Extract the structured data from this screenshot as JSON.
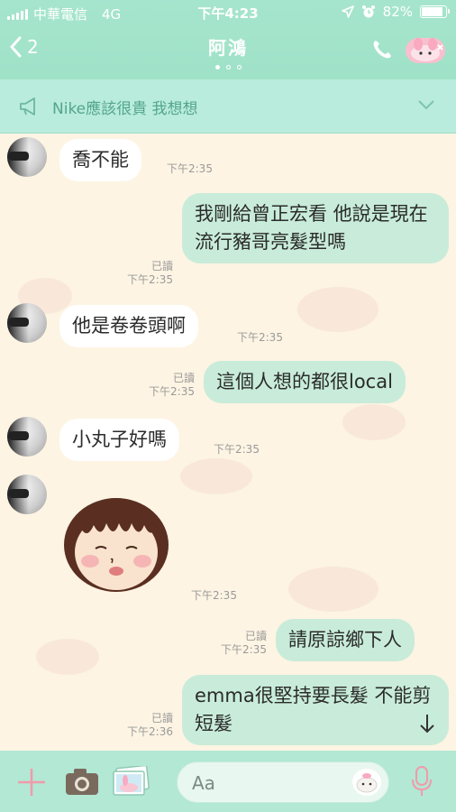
{
  "status_bar": {
    "carrier": "中華電信",
    "network": "4G",
    "time": "下午4:23",
    "battery": "82%",
    "battery_level": 0.82
  },
  "header": {
    "back_count": "2",
    "title": "阿鴻"
  },
  "notice": {
    "text": "Nike應該很貴 我想想"
  },
  "messages": [
    {
      "side": "in",
      "text": "喬不能",
      "time": "下午2:35"
    },
    {
      "side": "out",
      "text": "我剛給曾正宏看 他說是現在流行豬哥亮髮型嗎",
      "read": "已讀",
      "time": "下午2:35"
    },
    {
      "side": "in",
      "text": "他是卷卷頭啊",
      "time": "下午2:35"
    },
    {
      "side": "out",
      "text": "這個人想的都很local",
      "read": "已讀",
      "time": "下午2:35"
    },
    {
      "side": "in",
      "text": "小丸子好嗎",
      "time": "下午2:35"
    },
    {
      "side": "in",
      "type": "sticker",
      "sticker": "chibi-girl-sticker",
      "time": "下午2:35"
    },
    {
      "side": "out",
      "text": "請原諒鄉下人",
      "read": "已讀",
      "time": "下午2:35"
    },
    {
      "side": "out",
      "text": "emma很堅持要長髮 不能剪短髮",
      "read": "已讀",
      "time": "下午2:36"
    }
  ],
  "input": {
    "placeholder": "Aa"
  },
  "colors": {
    "header": "#a6e5cd",
    "bubble_out": "#c8ecd9",
    "bubble_in": "#ffffff",
    "background": "#fdf4e3"
  }
}
